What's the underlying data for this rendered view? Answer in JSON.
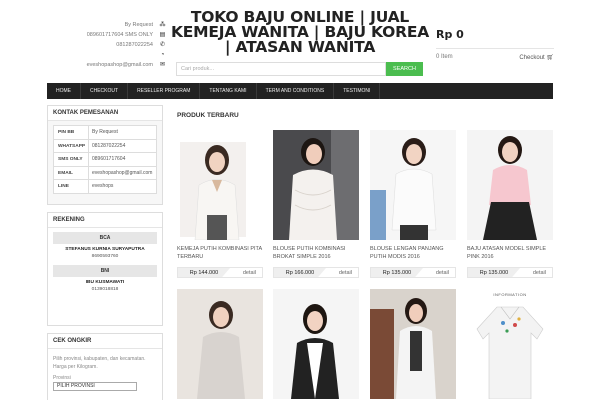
{
  "header": {
    "contacts": [
      {
        "text": "By Request",
        "icon": "bb-icon",
        "glyph": "⁂"
      },
      {
        "text": "089601717604 SMS ONLY",
        "icon": "sms-icon",
        "glyph": "▤"
      },
      {
        "text": "081287022254",
        "icon": "phone-icon",
        "glyph": "✆"
      },
      {
        "text": "",
        "icon": "whatsapp-icon",
        "glyph": "◔"
      },
      {
        "text": "eveshopashop@gmail.com",
        "icon": "mail-icon",
        "glyph": "✉"
      }
    ],
    "title": "TOKO BAJU ONLINE | JUAL KEMEJA WANITA | BAJU KOREA | ATASAN WANITA",
    "search": {
      "placeholder": "Cari produk...",
      "button": "SEARCH"
    },
    "cart": {
      "total": "Rp 0",
      "items": "0 Item",
      "checkout": "Checkout",
      "checkout_icon": "cart-icon"
    }
  },
  "nav": [
    "HOME",
    "CHECKOUT",
    "RESELLER PROGRAM",
    "TENTANG KAMI",
    "TERM AND CONDITIONS",
    "TESTIMONI"
  ],
  "sidebar": {
    "kontak": {
      "title": "KONTAK PEMESANAN",
      "rows": [
        {
          "label": "PIN BB",
          "value": "By Request"
        },
        {
          "label": "WHATSAPP",
          "value": "081287022254"
        },
        {
          "label": "SMS ONLY",
          "value": "089601717604"
        },
        {
          "label": "EMAIL",
          "value": "eveshopashop@gmail.com"
        },
        {
          "label": "LINE",
          "value": "eveshops"
        }
      ]
    },
    "rekening": {
      "title": "REKENING",
      "banks": [
        {
          "bank": "BCA",
          "name": "STEFANUS KURNIA SURYAPUTRA",
          "number": "8690593760"
        },
        {
          "bank": "BNI",
          "name": "IBU KUSMAWATI",
          "number": "0139018818"
        }
      ]
    },
    "ongkir": {
      "title": "CEK ONGKIR",
      "text": "Pilih provinsi, kabupaten, dan kecamatan. Harga per Kilogram.",
      "label": "Provinsi",
      "select": "PILIH PROVINSI"
    }
  },
  "products": {
    "title": "PRODUK TERBARU",
    "detail_label": "detail",
    "items": [
      {
        "name": "KEMEJA PUTIH KOMBINASI PITA TERBARU",
        "price": "Rp 144.000"
      },
      {
        "name": "BLOUSE PUTIH KOMBINASI BROKAT SIMPLE 2016",
        "price": "Rp 166.000"
      },
      {
        "name": "BLOUSE LENGAN PANJANG PUTIH MODIS 2016",
        "price": "Rp 135.000"
      },
      {
        "name": "BAJU ATASAN MODEL SIMPLE PINK 2016",
        "price": "Rp 135.000"
      },
      {
        "name": "",
        "price": ""
      },
      {
        "name": "",
        "price": ""
      },
      {
        "name": "",
        "price": ""
      },
      {
        "name": "",
        "price": ""
      }
    ],
    "overlay_text": "INFORMATION"
  },
  "colors": {
    "search_button": "#4bbd4f",
    "navbar": "#222222"
  }
}
